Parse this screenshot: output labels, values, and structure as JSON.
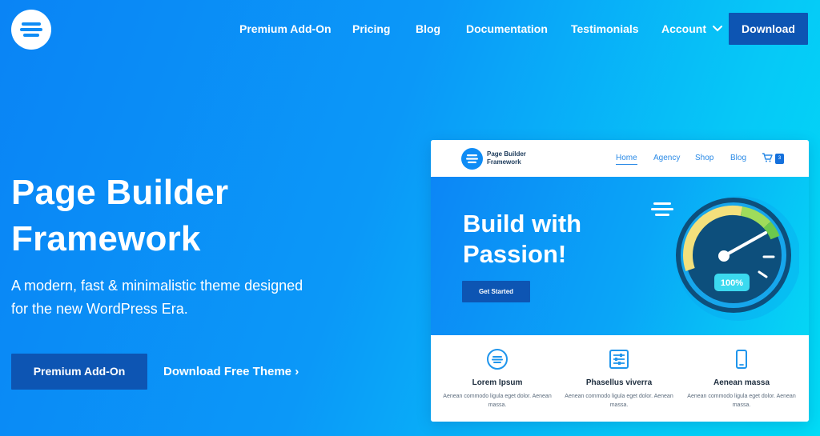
{
  "nav": {
    "items": [
      {
        "label": "Premium Add-On"
      },
      {
        "label": "Pricing"
      },
      {
        "label": "Blog"
      },
      {
        "label": "Documentation"
      },
      {
        "label": "Testimonials"
      },
      {
        "label": "Account"
      }
    ],
    "download_label": "Download"
  },
  "hero": {
    "title": "Page Builder Framework",
    "subtitle": "A modern, fast & minimalistic theme designed for the new WordPress Era.",
    "primary_button": "Premium Add-On",
    "secondary_link": "Download Free Theme ›"
  },
  "mockup": {
    "brand": "Page Builder Framework",
    "nav": [
      "Home",
      "Agency",
      "Shop",
      "Blog"
    ],
    "cart_count": "3",
    "headline": "Build with Passion!",
    "cta": "Get Started",
    "gauge_label": "100%",
    "gauge_value": 1.0,
    "features": [
      {
        "title": "Lorem Ipsum",
        "text": "Aenean commodo ligula eget dolor. Aenean massa."
      },
      {
        "title": "Phasellus viverra",
        "text": "Aenean commodo ligula eget dolor. Aenean massa."
      },
      {
        "title": "Aenean massa",
        "text": "Aenean commodo ligula eget dolor. Aenean massa."
      }
    ]
  },
  "colors": {
    "accent_dark": "#0d55b3",
    "gradient_start": "#0a84f5",
    "gradient_end": "#00dcf6"
  },
  "icons": {
    "logo": "logo-icon",
    "account_dropdown": "chevron-down-icon",
    "cart": "cart-icon",
    "feature_1": "logo-circle-icon",
    "feature_2": "sliders-icon",
    "feature_3": "mobile-phone-icon"
  }
}
